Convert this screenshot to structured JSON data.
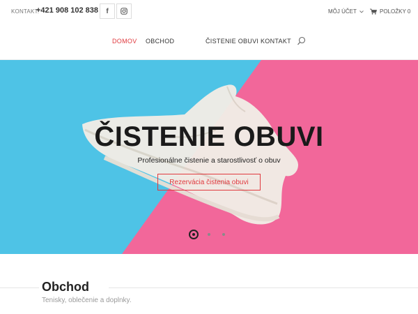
{
  "topbar": {
    "contact_label": "KONTAKT:",
    "phone": "+421 908 102 838",
    "facebook_label": "f",
    "account_label": "MÔJ ÚČET",
    "cart_label": "POLOŽKY 0"
  },
  "nav": {
    "items": [
      {
        "label": "DOMOV",
        "active": true
      },
      {
        "label": "OBCHOD"
      },
      {
        "label": "ČISTENIE OBUVI"
      },
      {
        "label": "KONTAKT"
      }
    ]
  },
  "hero": {
    "title": "ČISTENIE OBUVI",
    "subtitle": "Profesionálne čistenie a starostlivosť o obuv",
    "button": "Rezervácia čistenia obuvi",
    "slides_total": 3,
    "slide_active": 1
  },
  "section": {
    "title": "Obchod",
    "subtitle": "Tenisky, oblečenie a doplnky."
  },
  "colors": {
    "accent": "#e0393e",
    "hero_blue": "#4ec3e6",
    "hero_pink": "#f2679a"
  }
}
